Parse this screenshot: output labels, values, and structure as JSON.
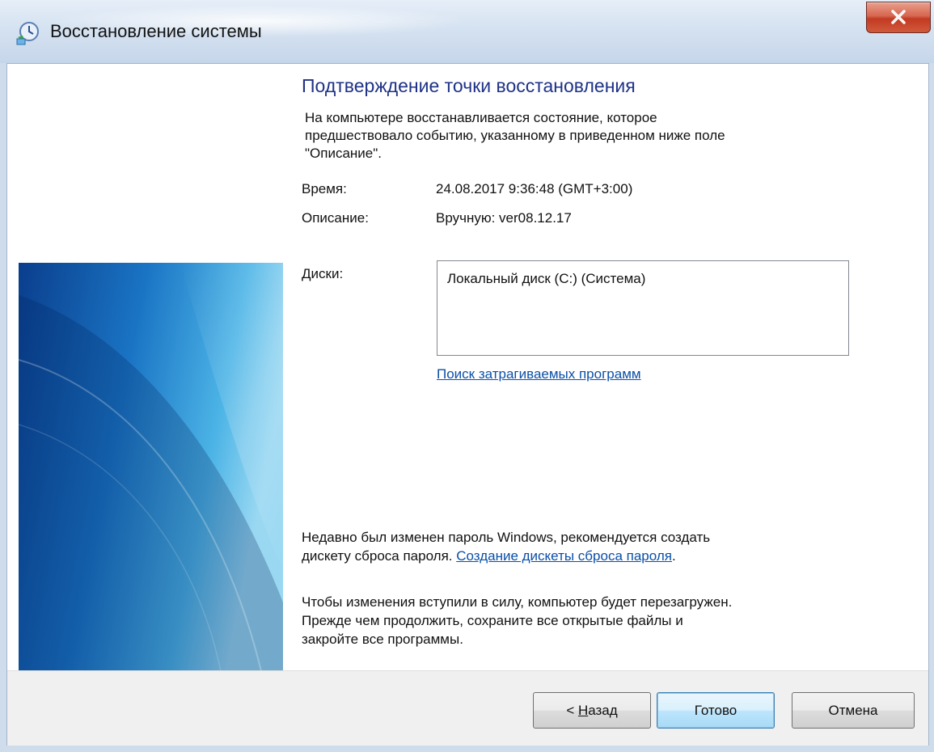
{
  "window": {
    "title": "Восстановление системы",
    "icon": "system-restore-icon"
  },
  "main": {
    "heading": "Подтверждение точки восстановления",
    "description_lines": [
      "На компьютере восстанавливается состояние, которое",
      "предшествовало событию, указанному в приведенном ниже поле",
      "\"Описание\"."
    ],
    "time_label": "Время:",
    "time_value": "24.08.2017 9:36:48 (GMT+3:00)",
    "description_label": "Описание:",
    "description_value": "Вручную: ver08.12.17",
    "disks_label": "Диски:",
    "disks": [
      "Локальный диск (C:) (Система)"
    ],
    "affected_programs_link": "Поиск затрагиваемых программ",
    "password_note_line1": "Недавно был изменен пароль Windows, рекомендуется создать",
    "password_note_line2_prefix": "дискету сброса пароля. ",
    "password_reset_link": "Создание дискеты сброса пароля",
    "password_note_line2_suffix": ".",
    "restart_note_lines": [
      "Чтобы изменения вступили в силу, компьютер будет перезагружен.",
      "Прежде чем продолжить, сохраните все открытые файлы и",
      "закройте все программы."
    ]
  },
  "buttons": {
    "back_prefix": "< ",
    "back_mnemonic": "Н",
    "back_rest": "азад",
    "finish": "Готово",
    "cancel": "Отмена"
  }
}
